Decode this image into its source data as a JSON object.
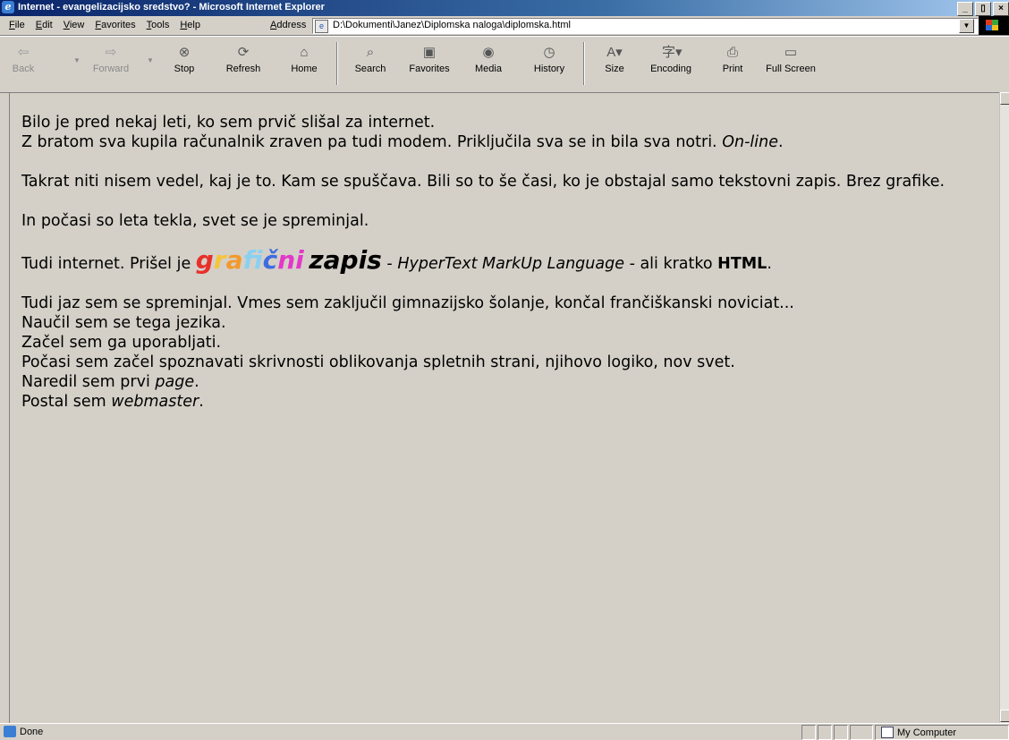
{
  "window": {
    "title": "Internet - evangelizacijsko sredstvo? - Microsoft Internet Explorer",
    "controls": [
      "_",
      "▯",
      "×"
    ]
  },
  "menu": {
    "items": [
      "File",
      "Edit",
      "View",
      "Favorites",
      "Tools",
      "Help"
    ]
  },
  "address": {
    "label": "Address",
    "value": "D:\\Dokumenti\\Janez\\Diplomska naloga\\diplomska.html"
  },
  "toolbar": {
    "back": "Back",
    "forward": "Forward",
    "stop": "Stop",
    "refresh": "Refresh",
    "home": "Home",
    "search": "Search",
    "favorites": "Favorites",
    "media": "Media",
    "history": "History",
    "size": "Size",
    "encoding": "Encoding",
    "print": "Print",
    "fullscreen": "Full Screen"
  },
  "content": {
    "p1_line1": "Bilo je pred nekaj leti, ko sem prvič slišal za internet.",
    "p1_line2": "Z bratom sva kupila računalnik zraven pa tudi modem. Priključila sva se in bila sva notri.",
    "p1_online": "On-line",
    "p2": "Takrat niti nisem vedel, kaj je to. Kam se spuščava. Bili so to še časi, ko je obstajal samo tekstovni zapis. Brez grafike.",
    "p3": "In počasi so leta tekla, svet se je spreminjal.",
    "p4_prefix": "Tudi internet. Prišel je",
    "p4_graficni_letters": [
      "g",
      "r",
      "a",
      "f",
      "i",
      "č",
      "n",
      "i"
    ],
    "p4_zapis": "zapis",
    "p4_dash1": "-",
    "p4_hypertext": "HyperText MarkUp Language",
    "p4_middle": "- ali kratko",
    "p4_html": "HTML",
    "p5_line1": "Tudi jaz sem se spreminjal. Vmes sem zaključil gimnazijsko šolanje, končal frančiškanski noviciat...",
    "p5_line2": "Naučil sem se tega jezika.",
    "p5_line3": "Začel sem ga uporabljati.",
    "p5_line4": "Počasi sem začel spoznavati skrivnosti oblikovanja spletnih strani, njihovo logiko, nov svet.",
    "p5_line5_prefix": "Naredil sem prvi",
    "p5_line5_em": "page",
    "p5_line6_prefix": "Postal sem",
    "p5_line6_em": "webmaster"
  },
  "status": {
    "text": "Done",
    "zone": "My Computer"
  },
  "colors": {
    "titlebar_start": "#0a246a",
    "titlebar_end": "#a6caf0",
    "page_background": "#d4d0c8",
    "graficni": [
      "#e8302a",
      "#f6c43a",
      "#f29a2e",
      "#8ad0f0",
      "#8ad0f0",
      "#3f6ce0",
      "#e338c9",
      "#e338c9"
    ]
  }
}
